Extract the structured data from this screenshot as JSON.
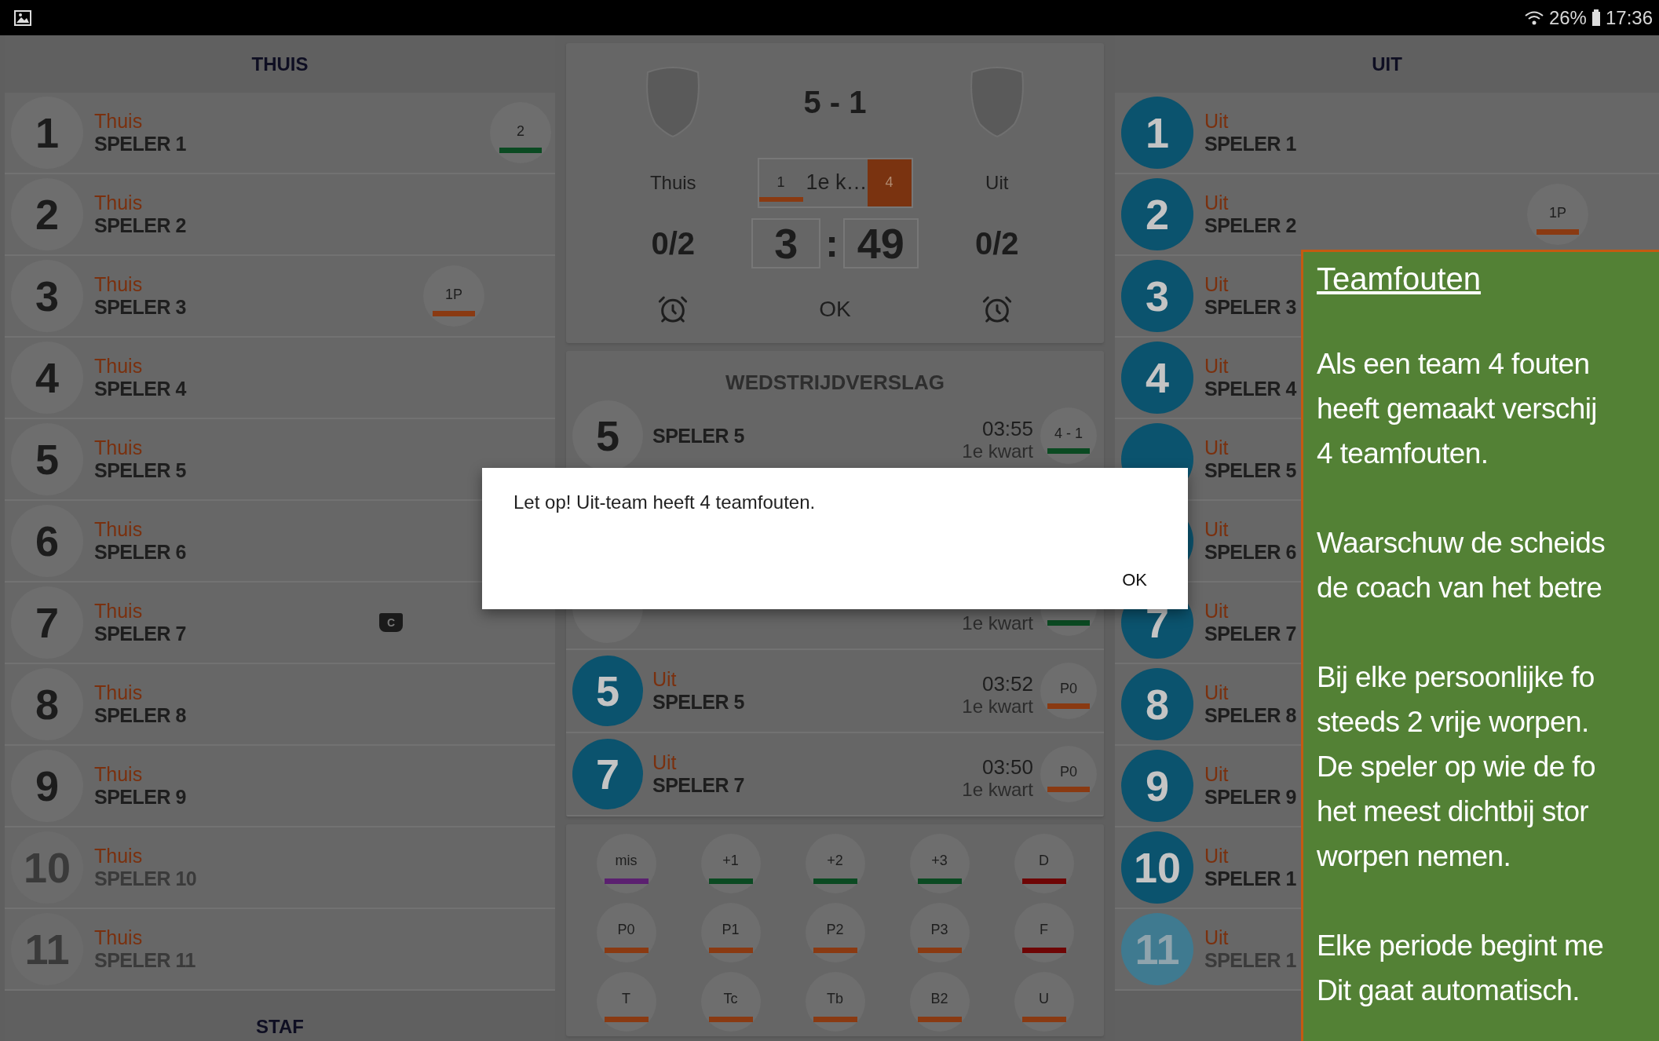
{
  "status_bar": {
    "battery": "26%",
    "time": "17:36"
  },
  "home": {
    "kind": "home",
    "title": "THUIS",
    "staff_title": "STAF",
    "players": [
      {
        "number": "1",
        "team": "Thuis",
        "name": "SPELER 1",
        "inactive": false,
        "badges": [
          {
            "kind": "points",
            "label": "2",
            "color": "#0b4a22"
          }
        ]
      },
      {
        "number": "2",
        "team": "Thuis",
        "name": "SPELER 2",
        "inactive": false
      },
      {
        "number": "3",
        "team": "Thuis",
        "name": "SPELER 3",
        "inactive": false,
        "badges": [
          {
            "kind": "foul",
            "label": "1P",
            "color": "#8a3a12"
          }
        ]
      },
      {
        "number": "4",
        "team": "Thuis",
        "name": "SPELER 4",
        "inactive": false
      },
      {
        "number": "5",
        "team": "Thuis",
        "name": "SPELER 5",
        "inactive": false
      },
      {
        "number": "6",
        "team": "Thuis",
        "name": "SPELER 6",
        "inactive": false
      },
      {
        "number": "7",
        "team": "Thuis",
        "name": "SPELER 7",
        "inactive": false,
        "badges": [
          {
            "kind": "captain",
            "label": "C"
          }
        ]
      },
      {
        "number": "8",
        "team": "Thuis",
        "name": "SPELER 8",
        "inactive": false
      },
      {
        "number": "9",
        "team": "Thuis",
        "name": "SPELER 9",
        "inactive": false
      },
      {
        "number": "10",
        "team": "Thuis",
        "name": "SPELER 10",
        "inactive": true
      },
      {
        "number": "11",
        "team": "Thuis",
        "name": "SPELER 11",
        "inactive": true
      }
    ]
  },
  "scoreboard": {
    "score": "5 - 1",
    "home_team": "Thuis",
    "away_team": "Uit",
    "period": {
      "number": "1",
      "label": "1e k…",
      "fouls": "4"
    },
    "home_timeouts": "0/2",
    "away_timeouts": "0/2",
    "minutes": "3",
    "separator": ":",
    "seconds": "49",
    "confirm": "OK"
  },
  "report": {
    "title": "WEDSTRIJDVERSLAG",
    "events": [
      {
        "kind": "home",
        "number": "5",
        "name": "SPELER 5",
        "time": "03:55",
        "period": "1e kwart",
        "badge": {
          "label": "4 - 1",
          "color": "#0b4a22"
        }
      },
      {
        "kind": "home",
        "period": "1e kwart",
        "badge": {
          "color": "#0b4a22"
        }
      },
      {
        "kind": "away",
        "number": "5",
        "team": "Uit",
        "name": "SPELER 5",
        "time": "03:52",
        "period": "1e kwart",
        "badge": {
          "label": "P0",
          "color": "#8a3a12"
        }
      },
      {
        "kind": "away",
        "number": "7",
        "team": "Uit",
        "name": "SPELER 7",
        "time": "03:50",
        "period": "1e kwart",
        "badge": {
          "label": "P0",
          "color": "#8a3a12"
        }
      }
    ]
  },
  "actions": [
    {
      "label": "mis",
      "color": "#5b2070"
    },
    {
      "label": "+1",
      "color": "#0b4a22"
    },
    {
      "label": "+2",
      "color": "#0b4a22"
    },
    {
      "label": "+3",
      "color": "#0b4a22"
    },
    {
      "label": "D",
      "color": "#6e0505"
    },
    {
      "label": "P0",
      "color": "#8a3a12"
    },
    {
      "label": "P1",
      "color": "#8a3a12"
    },
    {
      "label": "P2",
      "color": "#8a3a12"
    },
    {
      "label": "P3",
      "color": "#8a3a12"
    },
    {
      "label": "F",
      "color": "#6e0505"
    },
    {
      "label": "T",
      "color": "#8a3a12"
    },
    {
      "label": "Tc",
      "color": "#8a3a12"
    },
    {
      "label": "Tb",
      "color": "#8a3a12"
    },
    {
      "label": "B2",
      "color": "#8a3a12"
    },
    {
      "label": "U",
      "color": "#8a3a12"
    }
  ],
  "away": {
    "kind": "away",
    "title": "UIT",
    "players": [
      {
        "number": "1",
        "team": "Uit",
        "name": "SPELER 1",
        "inactive": false
      },
      {
        "number": "2",
        "team": "Uit",
        "name": "SPELER 2",
        "inactive": false,
        "badges": [
          {
            "kind": "foul",
            "label": "1P",
            "color": "#8a3a12"
          }
        ]
      },
      {
        "number": "3",
        "team": "Uit",
        "name": "SPELER 3",
        "inactive": false
      },
      {
        "number": "4",
        "team": "Uit",
        "name": "SPELER 4",
        "inactive": false
      },
      {
        "team": "Uit",
        "name": "SPELER 5",
        "inactive": false
      },
      {
        "team": "Uit",
        "name": "SPELER 6",
        "inactive": false
      },
      {
        "number": "7",
        "team": "Uit",
        "name": "SPELER 7",
        "inactive": false
      },
      {
        "number": "8",
        "team": "Uit",
        "name": "SPELER 8",
        "inactive": false
      },
      {
        "number": "9",
        "team": "Uit",
        "name": "SPELER 9",
        "inactive": false
      },
      {
        "number": "10",
        "team": "Uit",
        "name": "SPELER 1",
        "inactive": false
      },
      {
        "number": "11",
        "team": "Uit",
        "name": "SPELER 1",
        "inactive": true
      }
    ]
  },
  "dialog": {
    "message": "Let op! Uit-team heeft 4 teamfouten.",
    "button": "OK"
  },
  "callout": {
    "title": "Teamfouten",
    "paragraphs": [
      [
        "Als een team 4 fouten",
        "heeft gemaakt verschij",
        "4 teamfouten."
      ],
      [
        "Waarschuw de scheids",
        "de coach van het betre"
      ],
      [
        "Bij elke persoonlijke fo",
        "steeds 2 vrije worpen.",
        "De speler op wie de fo",
        "het meest dichtbij stor",
        "worpen nemen."
      ],
      [
        "Elke periode begint me",
        "Dit gaat automatisch."
      ]
    ]
  }
}
